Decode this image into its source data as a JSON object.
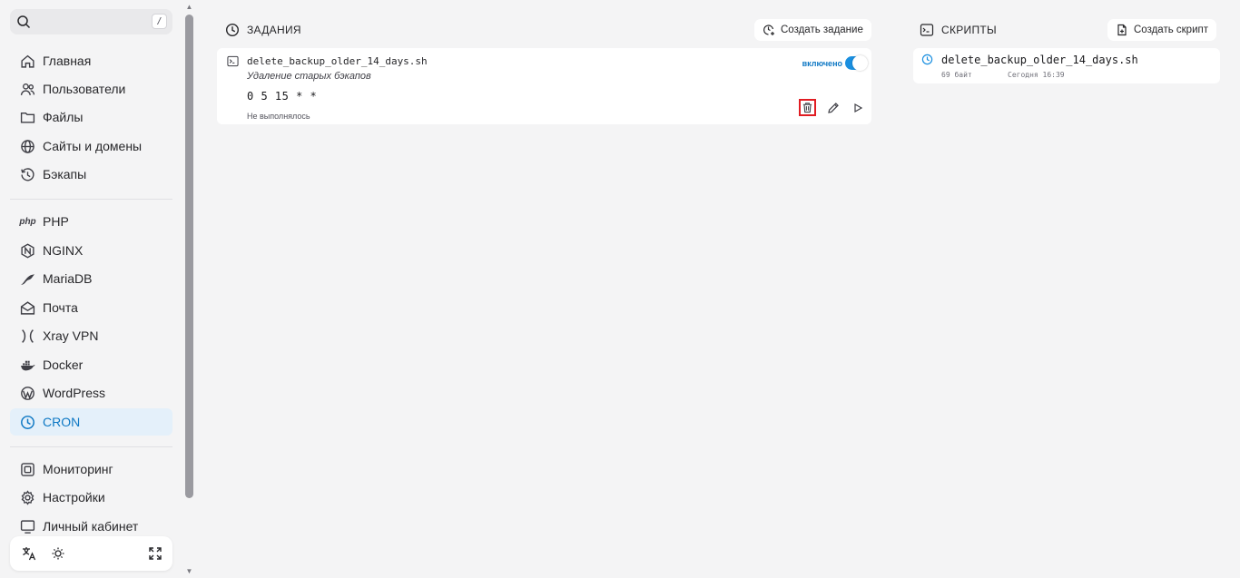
{
  "sidebar": {
    "search": {
      "shortcut": "/"
    },
    "nav_primary": [
      {
        "label": "Главная",
        "icon": "home-icon"
      },
      {
        "label": "Пользователи",
        "icon": "users-icon"
      },
      {
        "label": "Файлы",
        "icon": "folder-icon"
      },
      {
        "label": "Сайты и домены",
        "icon": "globe-icon"
      },
      {
        "label": "Бэкапы",
        "icon": "history-icon"
      }
    ],
    "nav_services": [
      {
        "label": "PHP",
        "icon": "php-icon",
        "icon_text": "php"
      },
      {
        "label": "NGINX",
        "icon": "nginx-icon"
      },
      {
        "label": "MariaDB",
        "icon": "mariadb-icon"
      },
      {
        "label": "Почта",
        "icon": "mail-icon"
      },
      {
        "label": "Xray VPN",
        "icon": "xray-icon"
      },
      {
        "label": "Docker",
        "icon": "docker-icon"
      },
      {
        "label": "WordPress",
        "icon": "wordpress-icon"
      },
      {
        "label": "CRON",
        "icon": "clock-icon",
        "active": true
      }
    ],
    "nav_system": [
      {
        "label": "Мониторинг",
        "icon": "monitor-icon"
      },
      {
        "label": "Настройки",
        "icon": "settings-icon"
      },
      {
        "label": "Личный кабинет",
        "icon": "account-icon"
      }
    ]
  },
  "jobs": {
    "title": "ЗАДАНИЯ",
    "create_label": "Создать задание",
    "items": [
      {
        "name": "delete_backup_older_14_days.sh",
        "description": "Удаление старых бэкапов",
        "schedule": "0 5 15 * *",
        "status": "Не выполнялось",
        "toggle_label": "включено",
        "enabled": true
      }
    ]
  },
  "scripts": {
    "title": "СКРИПТЫ",
    "create_label": "Создать скрипт",
    "items": [
      {
        "name": "delete_backup_older_14_days.sh",
        "size": "69 байт",
        "modified": "Сегодня 16:39"
      }
    ]
  },
  "colors": {
    "accent": "#0e78c4",
    "active_bg": "#e4f0fa",
    "highlight": "#e11d23"
  }
}
